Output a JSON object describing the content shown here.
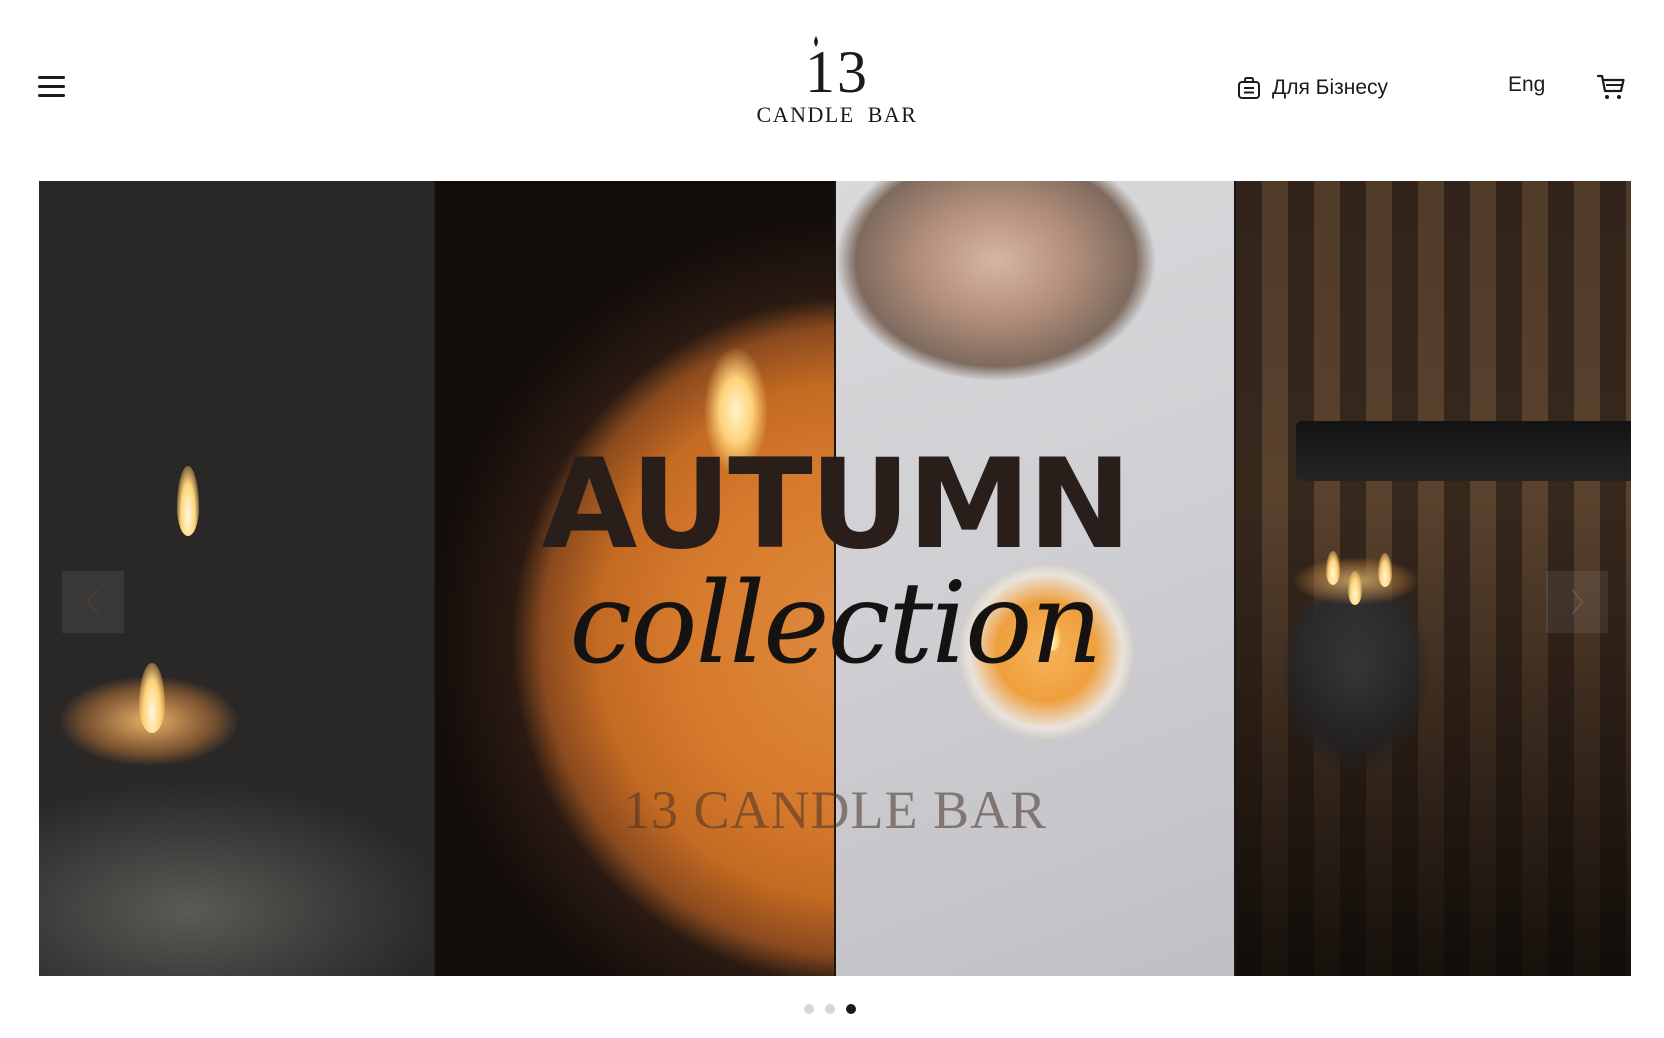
{
  "header": {
    "menu_icon": "hamburger-menu-icon",
    "logo": {
      "number": "13",
      "text": "CANDLE BAR"
    },
    "business_link": {
      "icon": "briefcase-icon",
      "label": "Для Бізнесу"
    },
    "language": "Eng",
    "cart_icon": "shopping-cart-icon"
  },
  "hero": {
    "title": "AUTUMN",
    "script": "collection",
    "brand": "13 CANDLE BAR",
    "prev_icon": "chevron-left-icon",
    "next_icon": "chevron-right-icon"
  },
  "carousel": {
    "slides": 3,
    "active_index": 3
  },
  "colors": {
    "text": "#1c1a1a",
    "title": "#2a1e1b",
    "dot_inactive": "#d6d6d6",
    "dot_active": "#1c1a1a"
  }
}
